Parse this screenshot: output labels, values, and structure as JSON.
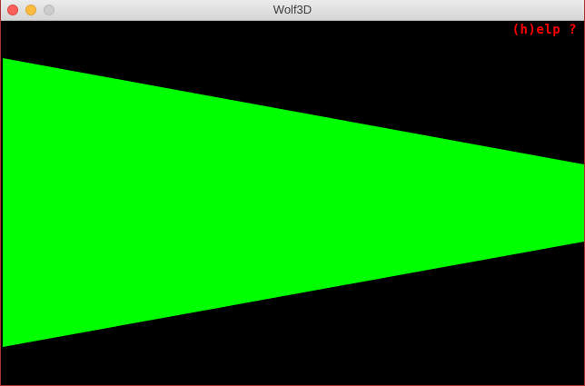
{
  "window": {
    "title": "Wolf3D"
  },
  "game": {
    "help_hint": "(h)elp ?",
    "wall_color": "#00ff00",
    "background_color": "#000000",
    "hud_color": "#ff0000"
  }
}
